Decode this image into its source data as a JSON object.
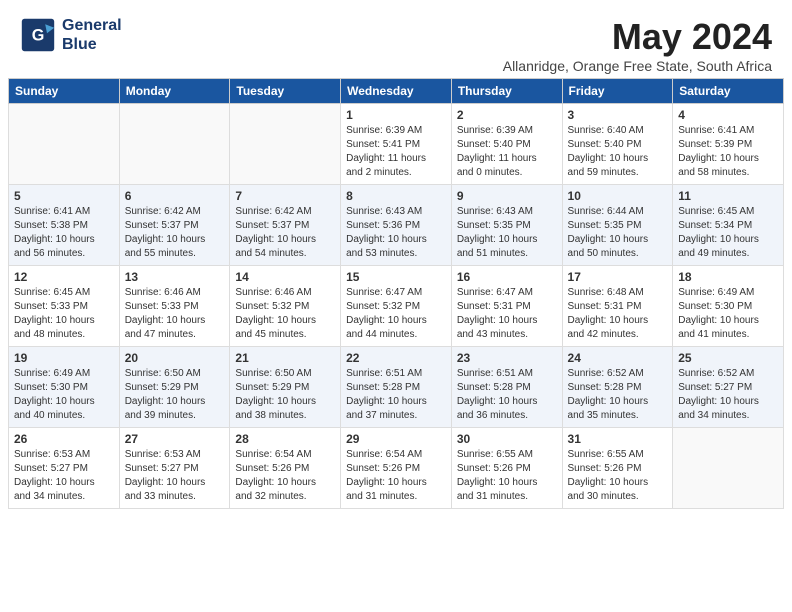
{
  "header": {
    "logo_line1": "General",
    "logo_line2": "Blue",
    "month_title": "May 2024",
    "subtitle": "Allanridge, Orange Free State, South Africa"
  },
  "weekdays": [
    "Sunday",
    "Monday",
    "Tuesday",
    "Wednesday",
    "Thursday",
    "Friday",
    "Saturday"
  ],
  "weeks": [
    [
      {
        "day": "",
        "info": ""
      },
      {
        "day": "",
        "info": ""
      },
      {
        "day": "",
        "info": ""
      },
      {
        "day": "1",
        "info": "Sunrise: 6:39 AM\nSunset: 5:41 PM\nDaylight: 11 hours\nand 2 minutes."
      },
      {
        "day": "2",
        "info": "Sunrise: 6:39 AM\nSunset: 5:40 PM\nDaylight: 11 hours\nand 0 minutes."
      },
      {
        "day": "3",
        "info": "Sunrise: 6:40 AM\nSunset: 5:40 PM\nDaylight: 10 hours\nand 59 minutes."
      },
      {
        "day": "4",
        "info": "Sunrise: 6:41 AM\nSunset: 5:39 PM\nDaylight: 10 hours\nand 58 minutes."
      }
    ],
    [
      {
        "day": "5",
        "info": "Sunrise: 6:41 AM\nSunset: 5:38 PM\nDaylight: 10 hours\nand 56 minutes."
      },
      {
        "day": "6",
        "info": "Sunrise: 6:42 AM\nSunset: 5:37 PM\nDaylight: 10 hours\nand 55 minutes."
      },
      {
        "day": "7",
        "info": "Sunrise: 6:42 AM\nSunset: 5:37 PM\nDaylight: 10 hours\nand 54 minutes."
      },
      {
        "day": "8",
        "info": "Sunrise: 6:43 AM\nSunset: 5:36 PM\nDaylight: 10 hours\nand 53 minutes."
      },
      {
        "day": "9",
        "info": "Sunrise: 6:43 AM\nSunset: 5:35 PM\nDaylight: 10 hours\nand 51 minutes."
      },
      {
        "day": "10",
        "info": "Sunrise: 6:44 AM\nSunset: 5:35 PM\nDaylight: 10 hours\nand 50 minutes."
      },
      {
        "day": "11",
        "info": "Sunrise: 6:45 AM\nSunset: 5:34 PM\nDaylight: 10 hours\nand 49 minutes."
      }
    ],
    [
      {
        "day": "12",
        "info": "Sunrise: 6:45 AM\nSunset: 5:33 PM\nDaylight: 10 hours\nand 48 minutes."
      },
      {
        "day": "13",
        "info": "Sunrise: 6:46 AM\nSunset: 5:33 PM\nDaylight: 10 hours\nand 47 minutes."
      },
      {
        "day": "14",
        "info": "Sunrise: 6:46 AM\nSunset: 5:32 PM\nDaylight: 10 hours\nand 45 minutes."
      },
      {
        "day": "15",
        "info": "Sunrise: 6:47 AM\nSunset: 5:32 PM\nDaylight: 10 hours\nand 44 minutes."
      },
      {
        "day": "16",
        "info": "Sunrise: 6:47 AM\nSunset: 5:31 PM\nDaylight: 10 hours\nand 43 minutes."
      },
      {
        "day": "17",
        "info": "Sunrise: 6:48 AM\nSunset: 5:31 PM\nDaylight: 10 hours\nand 42 minutes."
      },
      {
        "day": "18",
        "info": "Sunrise: 6:49 AM\nSunset: 5:30 PM\nDaylight: 10 hours\nand 41 minutes."
      }
    ],
    [
      {
        "day": "19",
        "info": "Sunrise: 6:49 AM\nSunset: 5:30 PM\nDaylight: 10 hours\nand 40 minutes."
      },
      {
        "day": "20",
        "info": "Sunrise: 6:50 AM\nSunset: 5:29 PM\nDaylight: 10 hours\nand 39 minutes."
      },
      {
        "day": "21",
        "info": "Sunrise: 6:50 AM\nSunset: 5:29 PM\nDaylight: 10 hours\nand 38 minutes."
      },
      {
        "day": "22",
        "info": "Sunrise: 6:51 AM\nSunset: 5:28 PM\nDaylight: 10 hours\nand 37 minutes."
      },
      {
        "day": "23",
        "info": "Sunrise: 6:51 AM\nSunset: 5:28 PM\nDaylight: 10 hours\nand 36 minutes."
      },
      {
        "day": "24",
        "info": "Sunrise: 6:52 AM\nSunset: 5:28 PM\nDaylight: 10 hours\nand 35 minutes."
      },
      {
        "day": "25",
        "info": "Sunrise: 6:52 AM\nSunset: 5:27 PM\nDaylight: 10 hours\nand 34 minutes."
      }
    ],
    [
      {
        "day": "26",
        "info": "Sunrise: 6:53 AM\nSunset: 5:27 PM\nDaylight: 10 hours\nand 34 minutes."
      },
      {
        "day": "27",
        "info": "Sunrise: 6:53 AM\nSunset: 5:27 PM\nDaylight: 10 hours\nand 33 minutes."
      },
      {
        "day": "28",
        "info": "Sunrise: 6:54 AM\nSunset: 5:26 PM\nDaylight: 10 hours\nand 32 minutes."
      },
      {
        "day": "29",
        "info": "Sunrise: 6:54 AM\nSunset: 5:26 PM\nDaylight: 10 hours\nand 31 minutes."
      },
      {
        "day": "30",
        "info": "Sunrise: 6:55 AM\nSunset: 5:26 PM\nDaylight: 10 hours\nand 31 minutes."
      },
      {
        "day": "31",
        "info": "Sunrise: 6:55 AM\nSunset: 5:26 PM\nDaylight: 10 hours\nand 30 minutes."
      },
      {
        "day": "",
        "info": ""
      }
    ]
  ]
}
